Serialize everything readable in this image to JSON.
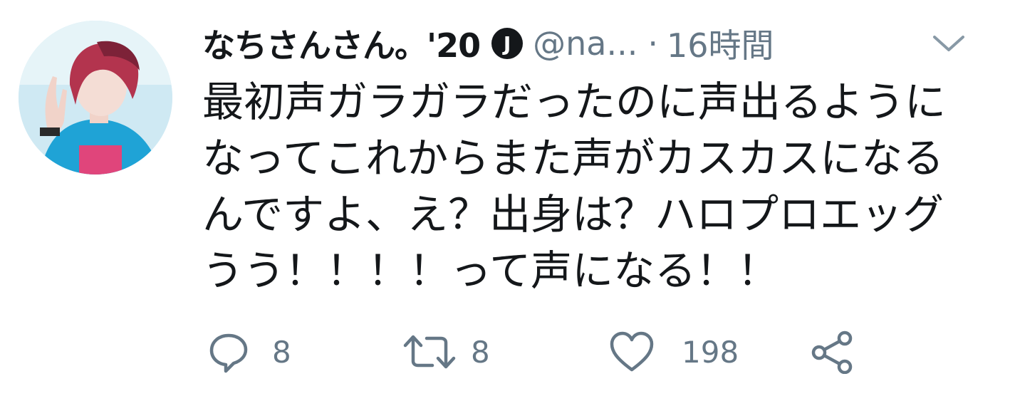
{
  "tweet": {
    "author": {
      "display_name": "なちさんさん。'20",
      "badge_letter": "J",
      "handle": "@na...",
      "avatar_icon": "user-avatar-photo"
    },
    "separator": "·",
    "time": "16時間",
    "caret_icon": "chevron-down-icon",
    "text_lines": [
      "最初声ガラガラだったのに声出るように",
      "なってこれからまた声がカスカスになる",
      "んですよ、え？出身は？ハロプロエッグ",
      "うう！！！！って声になる！！"
    ],
    "actions": {
      "reply": {
        "icon": "reply-icon",
        "count": "8"
      },
      "retweet": {
        "icon": "retweet-icon",
        "count": "8"
      },
      "like": {
        "icon": "heart-icon",
        "count": "198"
      },
      "share": {
        "icon": "share-icon"
      }
    }
  },
  "colors": {
    "text": "#14171a",
    "secondary": "#657786",
    "badge_bg": "#14171a",
    "background": "#ffffff"
  }
}
